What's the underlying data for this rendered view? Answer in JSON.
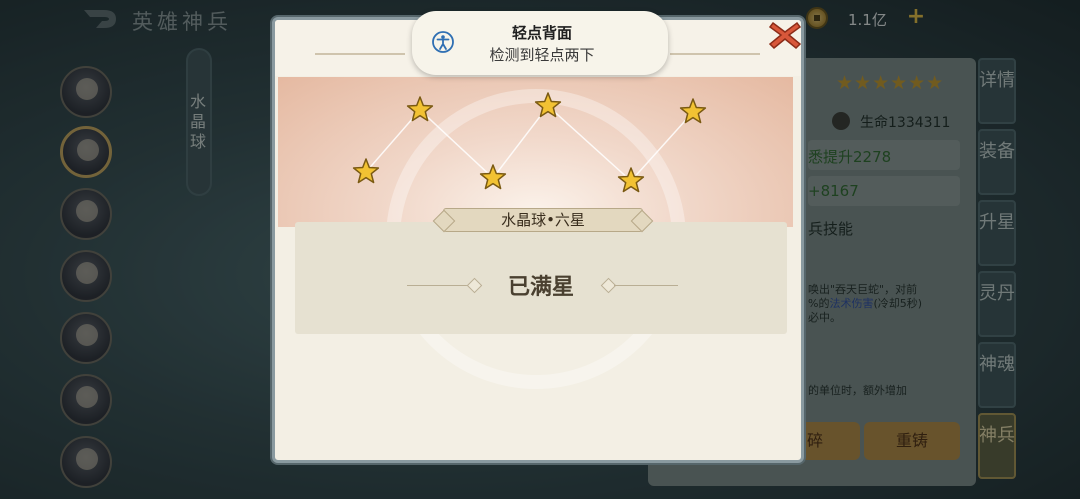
{
  "header": {
    "title": "英雄神兵",
    "currency_amount": "1.1亿",
    "back_icon": "back-arrow-icon",
    "coin_icon": "coin-icon",
    "add_icon": "plus-icon"
  },
  "left": {
    "weapon_tab": "水晶球",
    "avatars": [
      "hero-1",
      "hero-2",
      "hero-3",
      "hero-4",
      "hero-5",
      "hero-6",
      "hero-7"
    ],
    "selected_index": 1
  },
  "right_panel": {
    "stars": "★★★★★★",
    "life": "生命1334311",
    "boost1": "悉提升2278",
    "boost2": "+8167",
    "skill_title": "兵技能",
    "skill_line1": "唤出\"吞天巨蛇\"，对前",
    "skill_line2a": "%的",
    "skill_line2b": "法术伤害",
    "skill_line2c": "(冷却5秒)",
    "skill_line3": "必中。",
    "extra_line": "的单位时，额外增加",
    "btn_left": "碎",
    "btn_right": "重铸",
    "tabs": [
      "详情",
      "装备",
      "升星",
      "灵丹",
      "神魂",
      "神兵"
    ],
    "active_tab": 5
  },
  "modal": {
    "ribbon_title": "水晶球•六星",
    "status": "已满星",
    "star_count": 6,
    "close_icon": "close-icon"
  },
  "toast": {
    "title": "轻点背面",
    "subtitle": "检测到轻点两下",
    "icon": "accessibility-icon"
  },
  "colors": {
    "star_gold": "#f2c233",
    "close_red": "#d8573a",
    "ribbon": "#e3d8bf"
  }
}
